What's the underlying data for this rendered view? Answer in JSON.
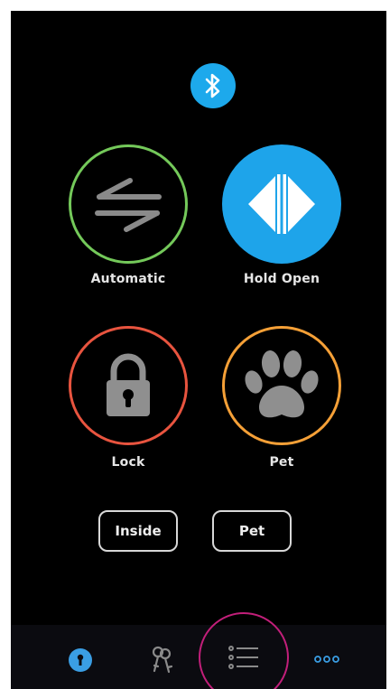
{
  "status": {
    "connection_icon": "bluetooth-icon",
    "connection_color": "#1da9ec"
  },
  "modes": {
    "automatic": {
      "label": "Automatic",
      "icon": "swap-arrows-icon",
      "ring_color": "#74c95a"
    },
    "hold_open": {
      "label": "Hold Open",
      "icon": "door-open-icon",
      "fill_color": "#1ea4ea",
      "selected": true
    },
    "lock": {
      "label": "Lock",
      "icon": "padlock-icon",
      "ring_color": "#e8543f"
    },
    "pet": {
      "label": "Pet",
      "icon": "paw-icon",
      "ring_color": "#f5a037"
    }
  },
  "toggles": {
    "inside": {
      "label": "Inside"
    },
    "pet": {
      "label": "Pet"
    }
  },
  "tabbar": {
    "tabs": [
      {
        "icon": "door-icon",
        "active": false
      },
      {
        "icon": "keys-icon",
        "active": false
      },
      {
        "icon": "list-icon",
        "active": true,
        "ring_color": "#c21f7a"
      },
      {
        "icon": "more-icon",
        "active": false
      }
    ]
  }
}
